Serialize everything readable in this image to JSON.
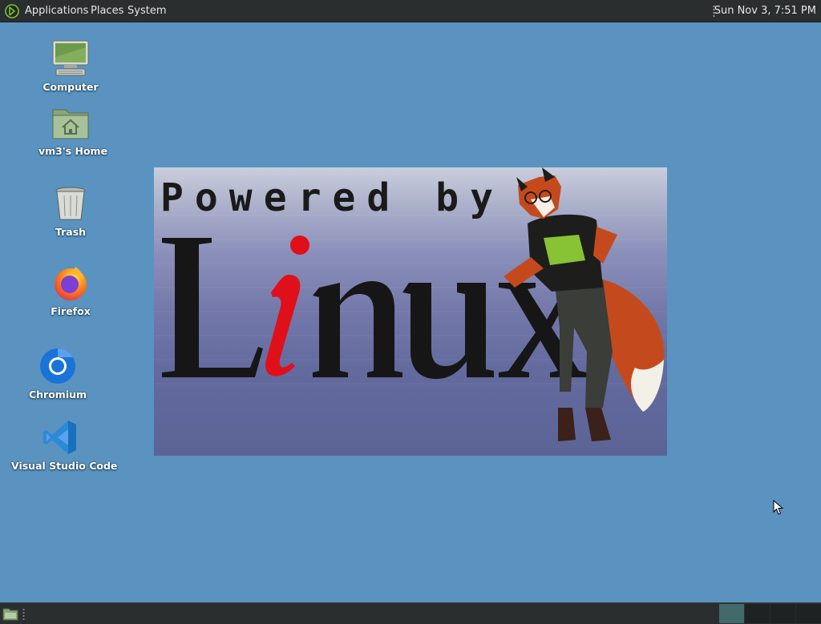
{
  "top_panel": {
    "menu_icon": "mate-logo-icon",
    "applications": "Applications",
    "places": "Places",
    "system": "System",
    "clock": "Sun Nov 3,  7:51 PM"
  },
  "desktop_icons": {
    "computer": "Computer",
    "home": "vm3's Home",
    "trash": "Trash",
    "firefox": "Firefox",
    "chromium": "Chromium",
    "vscode": "Visual Studio Code"
  },
  "wallpaper": {
    "powered_text": "Powered by",
    "linux_text": "Linux"
  },
  "bottom_panel": {
    "show_desktop_icon": "show-desktop-icon",
    "workspaces": [
      "1",
      "2",
      "3",
      "4"
    ],
    "active_workspace": 1
  },
  "colors": {
    "desktop": "#5a93bf",
    "panel": "#2b2e2f",
    "accent_red": "#e0101a"
  }
}
